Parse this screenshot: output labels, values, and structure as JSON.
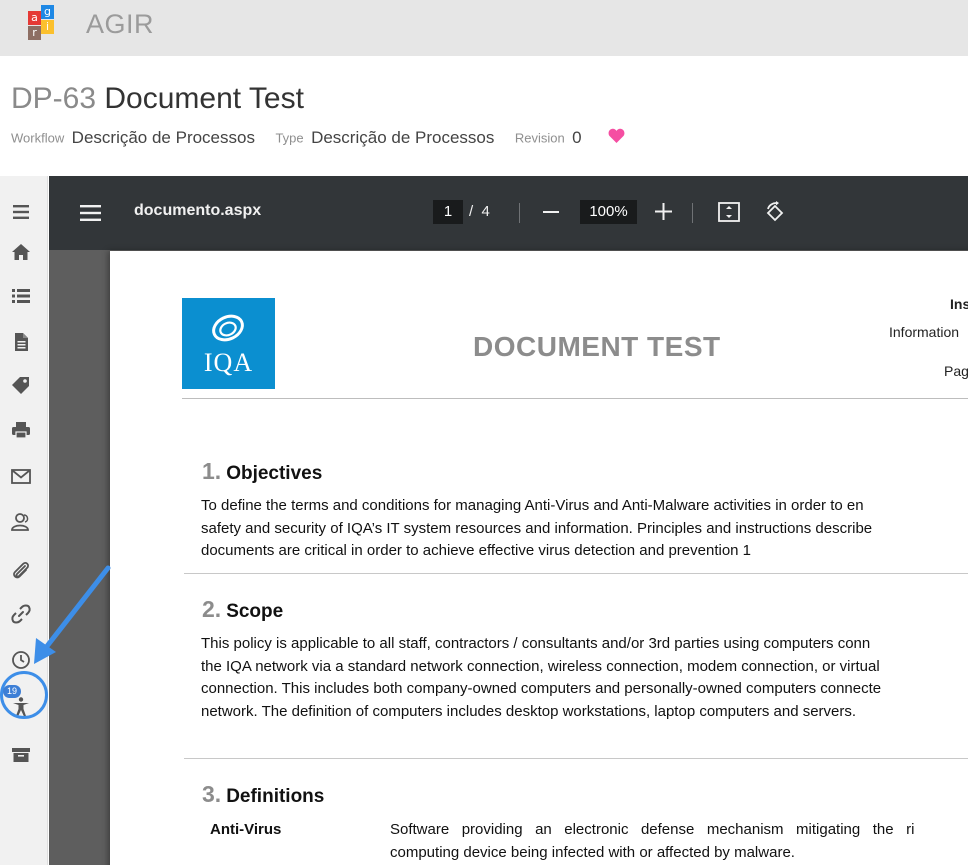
{
  "app": {
    "title": "AGIR",
    "logo_letters": [
      "a",
      "g",
      "r",
      "i"
    ],
    "logo_colors": [
      "#e53935",
      "#1e88e5",
      "#8d6e63",
      "#fbc02d"
    ]
  },
  "document": {
    "code": "DP-63",
    "name": "Document Test",
    "workflow_label": "Workflow",
    "workflow_value": "Descrição de Processos",
    "type_label": "Type",
    "type_value": "Descrição de Processos",
    "revision_label": "Revision",
    "revision_value": "0",
    "favorite_icon": "heart-icon",
    "favorite_color": "#f54ea2"
  },
  "sidebar": {
    "items": [
      {
        "icon": "menu-icon"
      },
      {
        "icon": "home-icon"
      },
      {
        "icon": "list-icon"
      },
      {
        "icon": "file-icon"
      },
      {
        "icon": "tags-icon"
      },
      {
        "icon": "print-icon"
      },
      {
        "icon": "mail-icon"
      },
      {
        "icon": "users-icon"
      },
      {
        "icon": "paperclip-icon"
      },
      {
        "icon": "link-icon"
      },
      {
        "icon": "clock-icon"
      },
      {
        "icon": "accessibility-icon",
        "badge": "19"
      },
      {
        "icon": "archive-icon"
      }
    ],
    "highlight_color": "#3d8ee8"
  },
  "viewer": {
    "filename": "documento.aspx",
    "current_page": "1",
    "page_separator": "/",
    "total_pages": "4",
    "zoom": "100%"
  },
  "pdf_page": {
    "logo_text": "IQA",
    "heading": "DOCUMENT TEST",
    "header_right_1": "Ins",
    "header_right_2": "Information",
    "header_right_3": "Pag",
    "sections": [
      {
        "number": "1.",
        "title": "Objectives",
        "lines": [
          "To define the terms and conditions for managing Anti-Virus and Anti-Malware activities in order to en",
          "safety and security of IQA’s IT system resources and information. Principles and instructions describe",
          "documents are critical in order to achieve effective virus detection and prevention 1"
        ]
      },
      {
        "number": "2.",
        "title": "Scope",
        "lines": [
          "This policy is applicable to all staff, contractors / consultants and/or 3rd parties using computers conn",
          "the IQA network via a standard network connection, wireless connection, modem connection, or virtual",
          "connection. This includes both company-owned computers and personally-owned computers connecte",
          "network. The definition of computers includes desktop workstations, laptop computers and servers."
        ]
      },
      {
        "number": "3.",
        "title": "Definitions",
        "lines": []
      }
    ],
    "definition": {
      "term": "Anti-Virus",
      "lines": [
        "Software   providing   an   electronic   defense   mechanism   mitigating   the   ri",
        "computing device being infected with or affected by malware."
      ]
    }
  }
}
